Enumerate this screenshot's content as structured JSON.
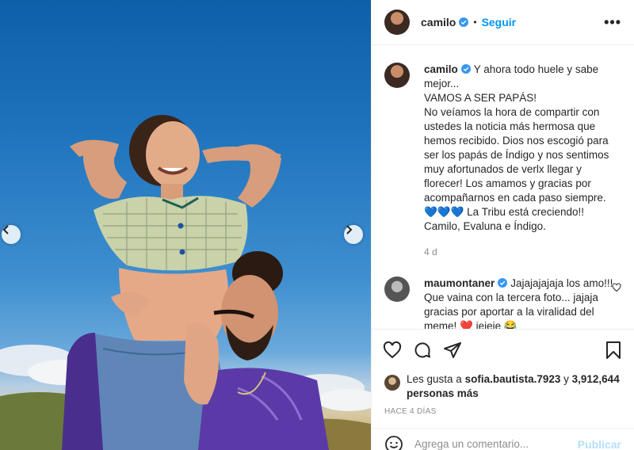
{
  "post": {
    "author": "camilo",
    "follow_label": "Seguir",
    "more_label": "•••",
    "separator": "•"
  },
  "caption": {
    "author": "camilo",
    "lines": [
      "Y ahora todo huele y sabe mejor...",
      "VAMOS A SER PAPÁS!",
      "No veíamos la hora de compartir con ustedes la noticia más hermosa que hemos recibido. Dios nos escogió para ser los papás de Índigo y nos sentimos muy afortunados de verlx llegar y florecer! Los amamos y gracias por acompañarnos en cada paso siempre.",
      "💙💙💙 La Tribu está creciendo!! Camilo, Evaluna e Índigo."
    ],
    "time": "4 d"
  },
  "comment": {
    "author": "maumontaner",
    "text": "Jajajajajaja los amo!!! Que vaina con la tercera foto... jajaja gracias por aportar a la viralidad del meme! ❤️ jejeje 😂"
  },
  "likes": {
    "prefix": "Les gusta a ",
    "user": "sofia.bautista.7923",
    "middle": " y ",
    "count": "3,912,644 personas más"
  },
  "time_ago": "HACE 4 DÍAS",
  "add_comment": {
    "placeholder": "Agrega un comentario...",
    "publish_label": "Publicar"
  },
  "colors": {
    "accent": "#0095f6",
    "verified": "#3897f0",
    "muted": "#8e8e8e"
  }
}
